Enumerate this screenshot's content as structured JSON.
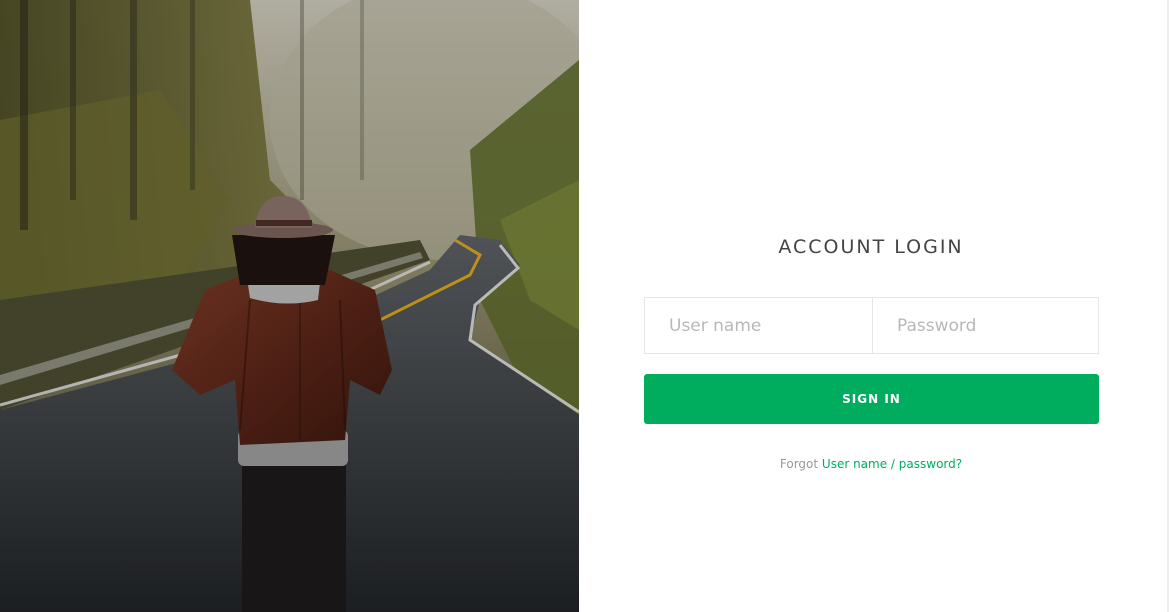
{
  "login": {
    "title": "ACCOUNT LOGIN",
    "username_placeholder": "User name",
    "password_placeholder": "Password",
    "sign_in_label": "SIGN IN",
    "forgot_prefix": "Forgot",
    "forgot_link": "User name / password?"
  },
  "colors": {
    "accent": "#00ad5f",
    "title": "#444444",
    "muted": "#999999"
  }
}
